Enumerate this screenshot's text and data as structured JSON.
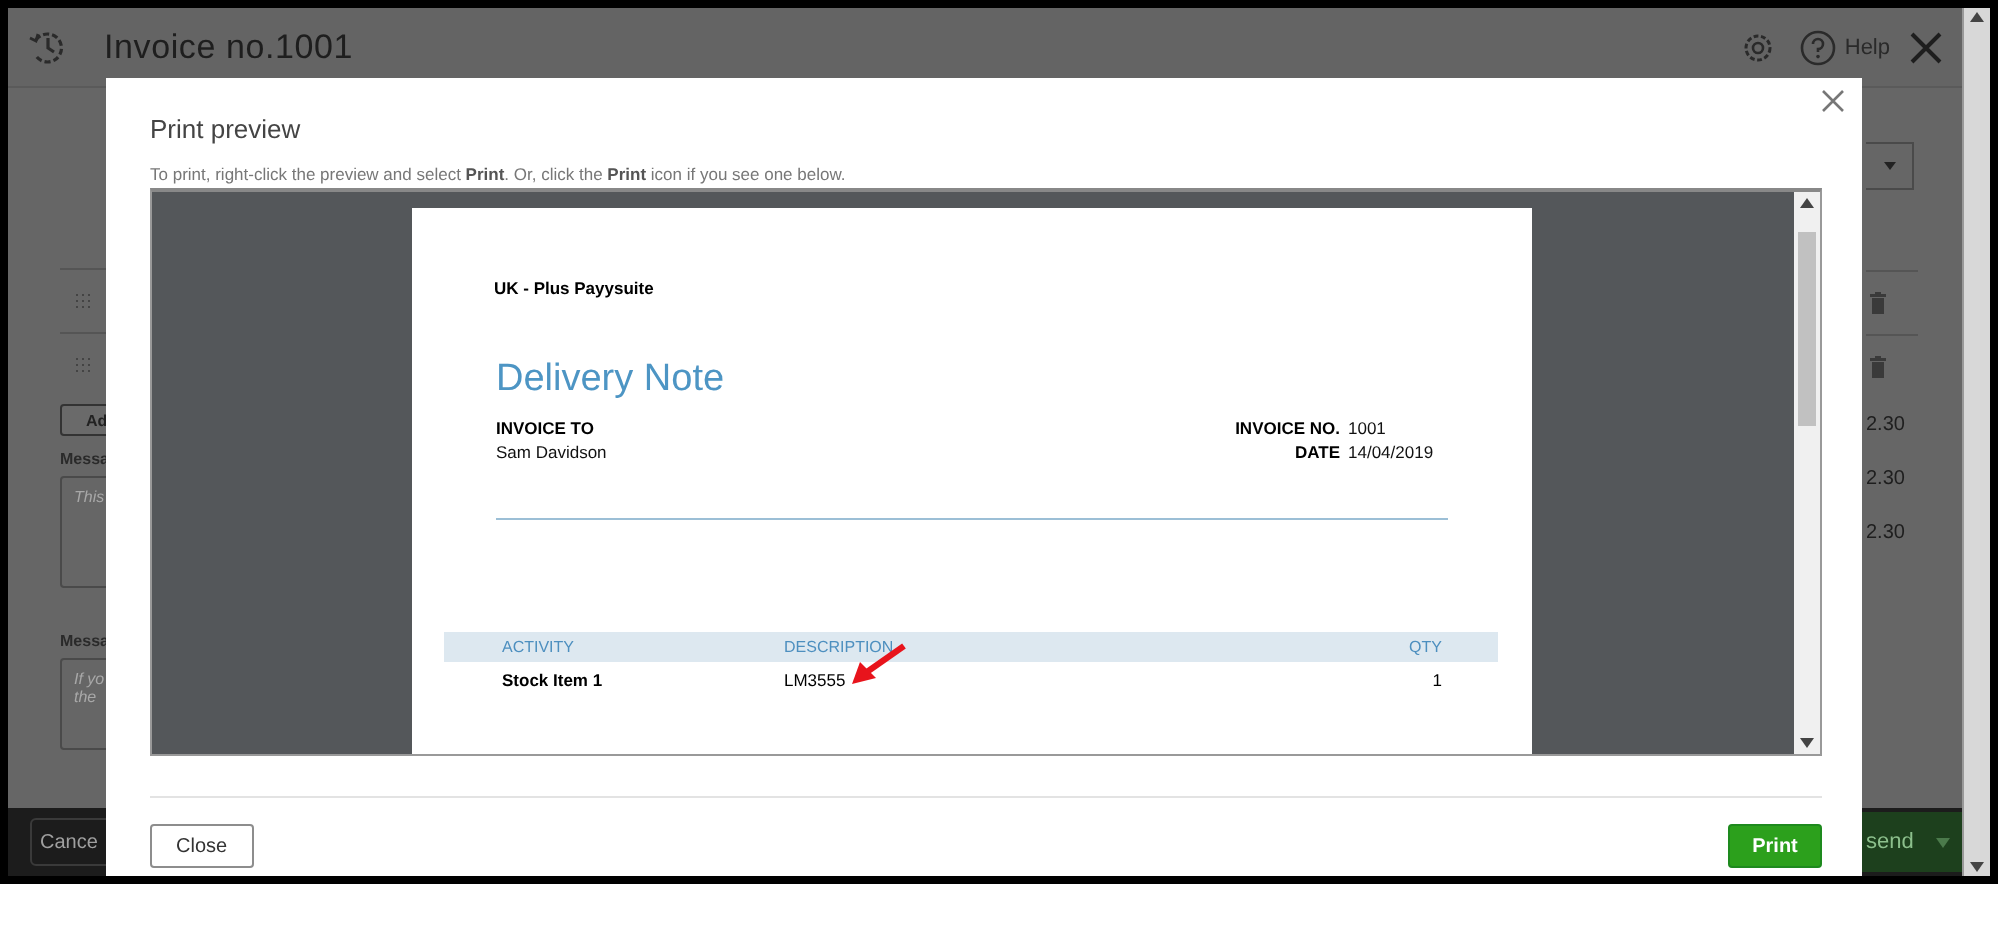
{
  "app": {
    "title": "Invoice no.1001",
    "help": "Help",
    "add_button": "Ad",
    "messages": [
      {
        "label": "Messa",
        "placeholder_lines": [
          "This"
        ]
      },
      {
        "label": "Messa",
        "placeholder_lines": [
          "If yo",
          "the"
        ]
      }
    ],
    "amounts": [
      "2.30",
      "2.30",
      "2.30"
    ],
    "footer": {
      "cancel": "Cance",
      "send": "send"
    }
  },
  "dialog": {
    "title": "Print preview",
    "instruction": "To print, right-click the preview and select **Print**. Or, click the **Print** icon if you see one below.",
    "document": {
      "company": "UK - Plus Payysuite",
      "heading": "Delivery Note",
      "invoice_to_label": "INVOICE TO",
      "customer": "Sam Davidson",
      "meta": [
        {
          "label": "INVOICE NO.",
          "value": "1001"
        },
        {
          "label": "DATE",
          "value": "14/04/2019"
        }
      ],
      "columns": [
        "ACTIVITY",
        "DESCRIPTION",
        "QTY"
      ],
      "rows": [
        [
          "Stock Item 1",
          "LM3555",
          "1"
        ]
      ]
    },
    "buttons": {
      "close": "Close",
      "print": "Print"
    }
  }
}
